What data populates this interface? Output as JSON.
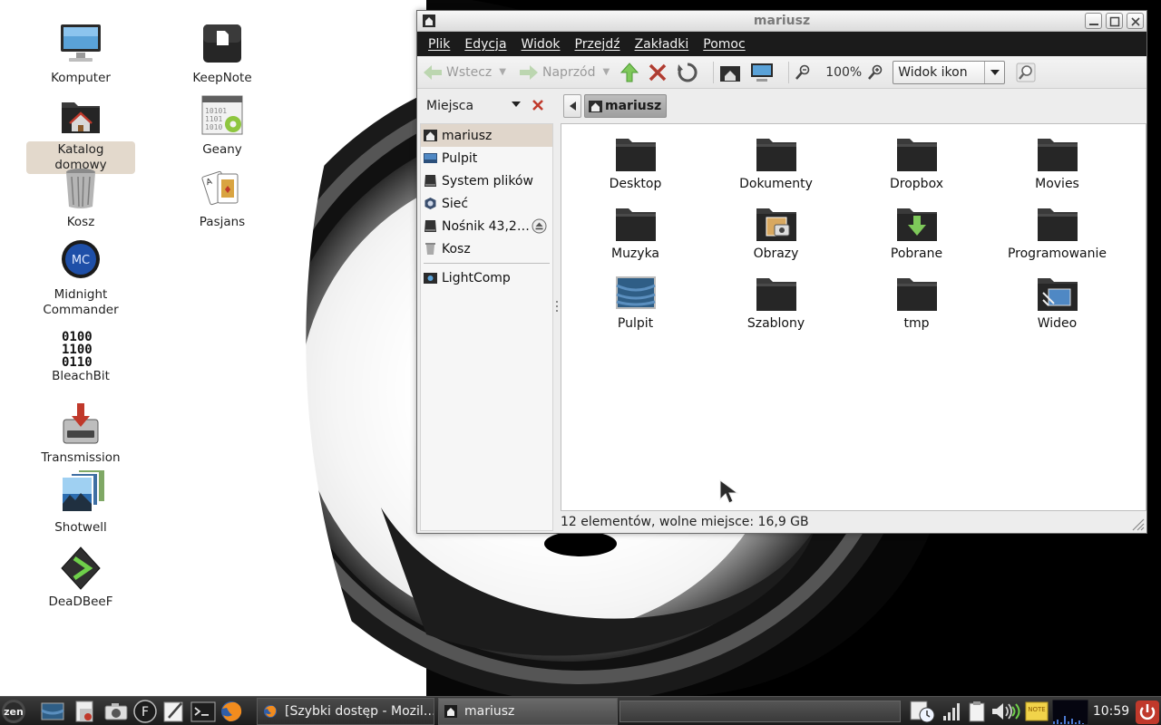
{
  "desktop": {
    "icons": [
      {
        "label": "Komputer"
      },
      {
        "label": "Katalog domowy"
      },
      {
        "label": "Kosz"
      },
      {
        "label": "Midnight Commander"
      },
      {
        "label": "BleachBit"
      },
      {
        "label": "Transmission"
      },
      {
        "label": "Shotwell"
      },
      {
        "label": "DeaDBeeF"
      },
      {
        "label": "KeepNote"
      },
      {
        "label": "Geany"
      },
      {
        "label": "Pasjans"
      }
    ]
  },
  "window": {
    "title": "mariusz",
    "menu": [
      "Plik",
      "Edycja",
      "Widok",
      "Przejdź",
      "Zakładki",
      "Pomoc"
    ],
    "toolbar": {
      "back_label": "Wstecz",
      "forward_label": "Naprzód",
      "zoom": "100%",
      "view_mode": "Widok ikon"
    },
    "sidepane": {
      "header": "Miejsca",
      "places": [
        "mariusz",
        "Pulpit",
        "System plików",
        "Sieć",
        "Nośnik 43,2…",
        "Kosz"
      ],
      "bookmarks": [
        "LightComp"
      ]
    },
    "location": {
      "crumb": "mariusz"
    },
    "files": [
      "Desktop",
      "Dokumenty",
      "Dropbox",
      "Movies",
      "Muzyka",
      "Obrazy",
      "Pobrane",
      "Programowanie",
      "Pulpit",
      "Szablony",
      "tmp",
      "Wideo"
    ],
    "status": "12 elementów, wolne miejsce: 16,9 GB"
  },
  "taskbar": {
    "tasks": [
      "[Szybki dostęp - Mozil…",
      "mariusz"
    ],
    "clock": "10:59",
    "note_label": "NOTE"
  },
  "colors": {
    "menubar": "#1b1b1b",
    "selection": "#e0d6cb",
    "folder": "#2f2f2f",
    "taskbar": "#2a2a2a"
  }
}
